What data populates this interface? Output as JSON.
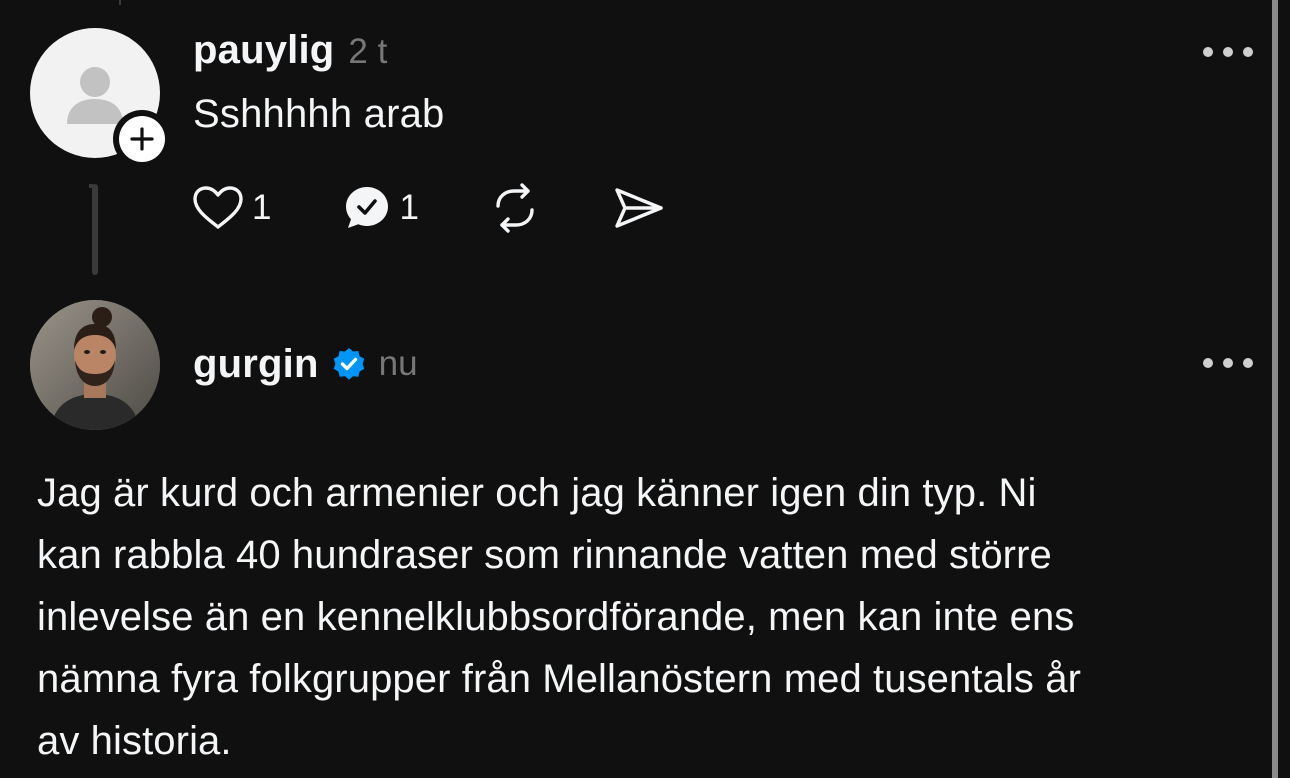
{
  "posts": [
    {
      "username": "pauylig",
      "time": "2 t",
      "text": "Sshhhhh arab",
      "actions": {
        "likes": "1",
        "replies": "1"
      },
      "avatar_icon": "default-person-icon",
      "follow_icon": "plus-icon"
    },
    {
      "username": "gurgin",
      "verified": true,
      "time": "nu",
      "text_lines": [
        "Jag är kurd och armenier och jag känner igen din typ. Ni",
        "kan rabbla 40 hundraser som rinnande vatten med större",
        "inlevelse än en kennelklubbsordförande, men kan inte ens",
        "nämna fyra folkgrupper från Mellanöstern med tusentals år",
        "av historia."
      ]
    }
  ],
  "colors": {
    "background": "#101010",
    "text": "#f3f5f7",
    "muted": "#777777",
    "verified": "#0095f6",
    "thread_line": "#3a3a3a"
  }
}
